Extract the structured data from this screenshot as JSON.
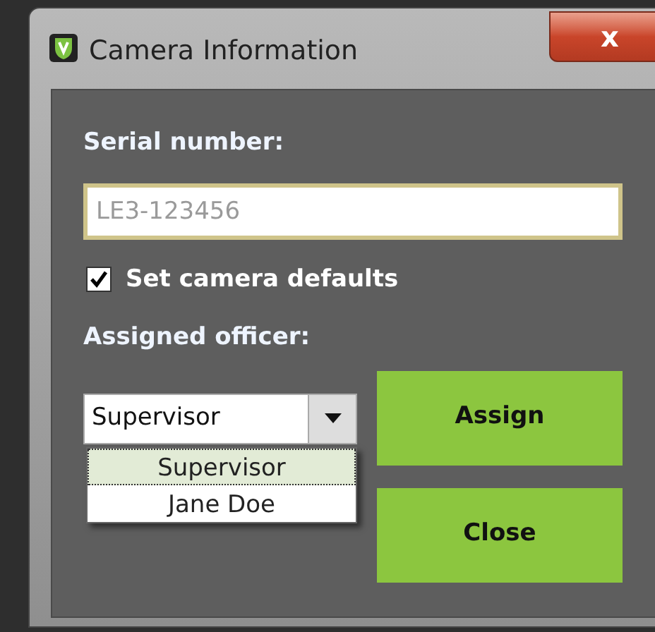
{
  "window": {
    "title": "Camera Information",
    "close": "x"
  },
  "serial": {
    "label": "Serial number:",
    "value": "LE3-123456"
  },
  "defaults": {
    "label": "Set camera defaults",
    "checked": true
  },
  "officer": {
    "label": "Assigned officer:",
    "value": "Supervisor",
    "expanded": true,
    "options": [
      {
        "label": "Supervisor",
        "selected": true
      },
      {
        "label": "Jane Doe",
        "selected": false
      }
    ]
  },
  "buttons": [
    {
      "label": "Assign"
    },
    {
      "label": "Close"
    }
  ]
}
